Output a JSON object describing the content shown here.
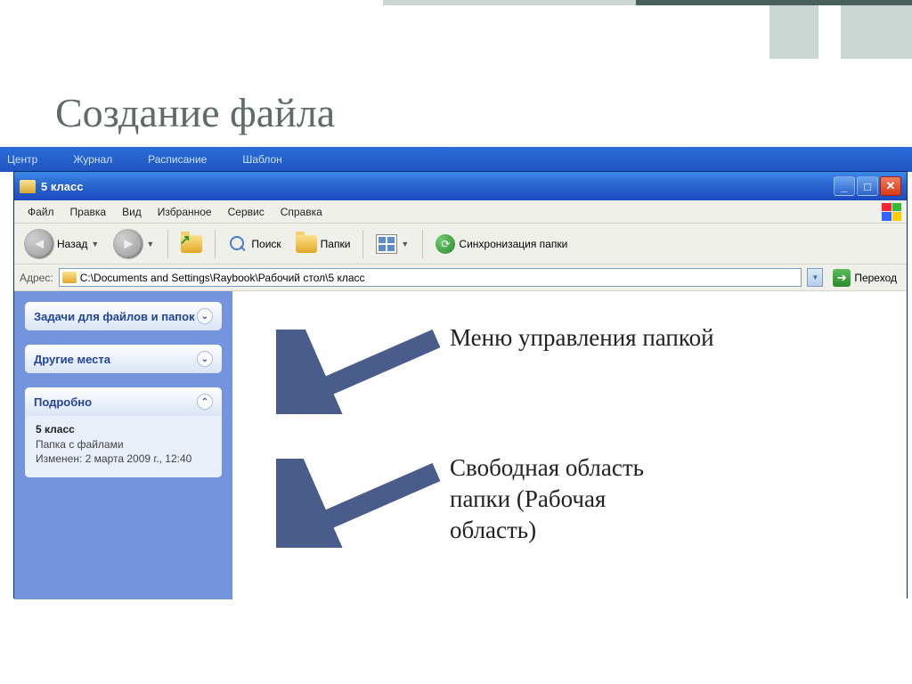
{
  "slide": {
    "title": "Создание файла"
  },
  "bg_titlebar": {
    "items": [
      "Центр",
      "Журнал",
      "Расписание",
      "Шаблон"
    ]
  },
  "window": {
    "title": "5 класс",
    "min": "_",
    "max": "□",
    "close": "✕"
  },
  "menu": {
    "items": [
      "Файл",
      "Правка",
      "Вид",
      "Избранное",
      "Сервис",
      "Справка"
    ]
  },
  "toolbar": {
    "back": "Назад",
    "search": "Поиск",
    "folders": "Папки",
    "sync": "Синхронизация папки"
  },
  "address": {
    "label": "Адрес:",
    "path": "C:\\Documents and Settings\\Raybook\\Рабочий стол\\5 класс",
    "go": "Переход"
  },
  "sidebar": {
    "tasks": {
      "title": "Задачи для файлов и папок"
    },
    "places": {
      "title": "Другие места"
    },
    "details": {
      "title": "Подробно",
      "name": "5 класс",
      "type": "Папка с файлами",
      "modified": "Изменен: 2 марта 2009 г., 12:40"
    }
  },
  "annotations": {
    "menu": "Меню управления папкой",
    "workarea_l1": "Свободная область",
    "workarea_l2": "папки (Рабочая",
    "workarea_l3": "область)"
  }
}
